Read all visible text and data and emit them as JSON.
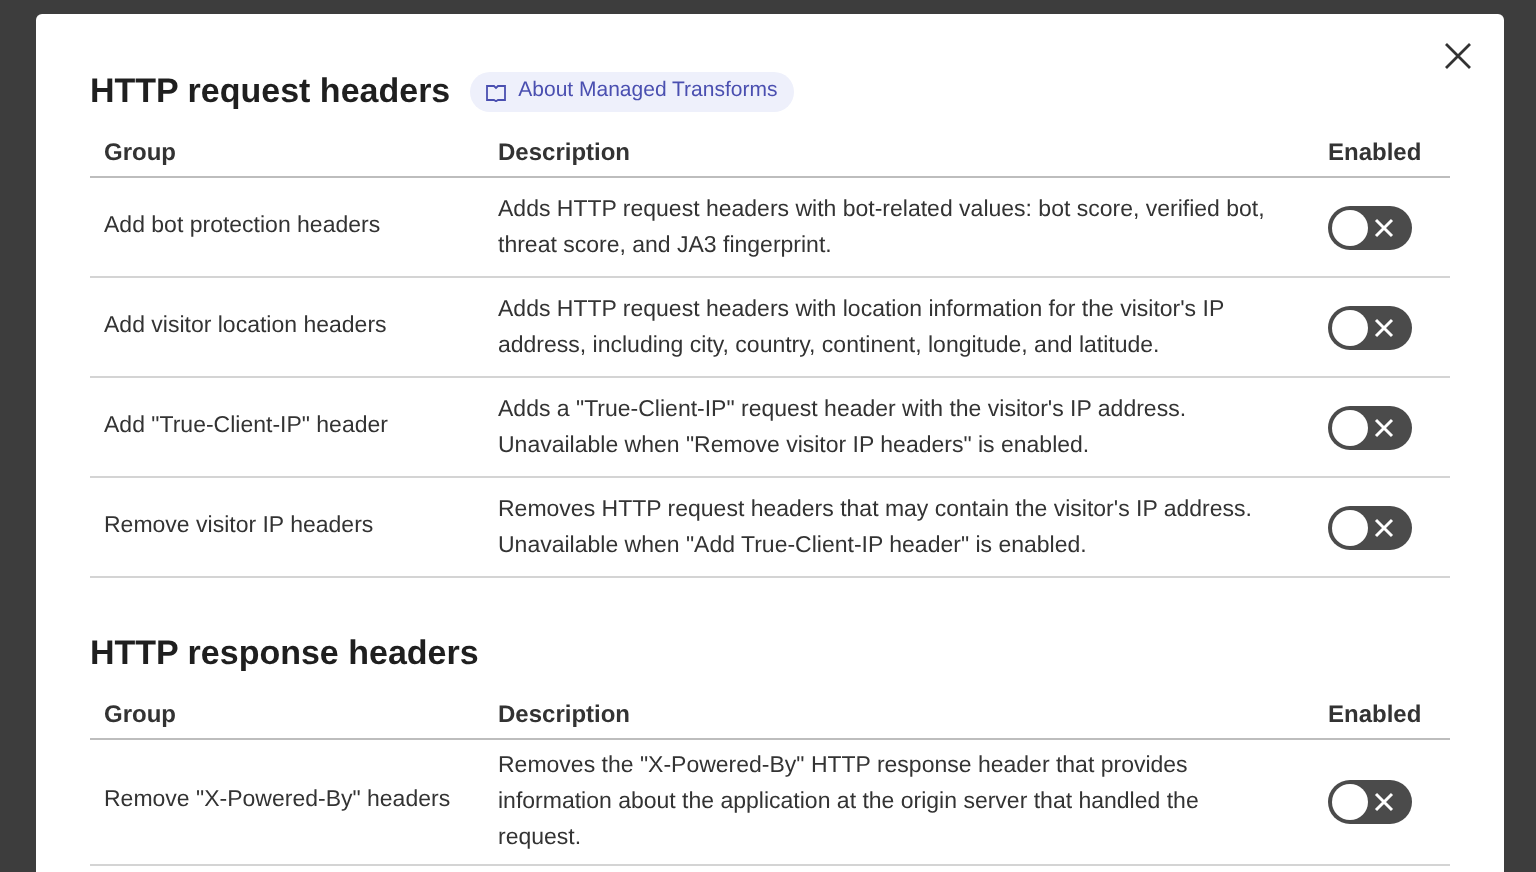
{
  "sections": [
    {
      "title": "HTTP request headers",
      "link": "About Managed Transforms",
      "columns": [
        "Group",
        "Description",
        "Enabled"
      ],
      "rows": [
        {
          "group": "Add bot protection headers",
          "description": "Adds HTTP request headers with bot-related values: bot score, verified bot, threat score, and JA3 fingerprint.",
          "enabled": false
        },
        {
          "group": "Add visitor location headers",
          "description": "Adds HTTP request headers with location information for the visitor's IP address, including city, country, continent, longitude, and latitude.",
          "enabled": false
        },
        {
          "group": "Add \"True-Client-IP\" header",
          "description": "Adds a \"True-Client-IP\" request header with the visitor's IP address. Unavailable when \"Remove visitor IP headers\" is enabled.",
          "enabled": false
        },
        {
          "group": "Remove visitor IP headers",
          "description": "Removes HTTP request headers that may contain the visitor's IP address. Unavailable when \"Add True-Client-IP header\" is enabled.",
          "enabled": false
        }
      ]
    },
    {
      "title": "HTTP response headers",
      "columns": [
        "Group",
        "Description",
        "Enabled"
      ],
      "rows": [
        {
          "group": "Remove \"X-Powered-By\" headers",
          "description": "Removes the \"X-Powered-By\" HTTP response header that provides information about the application at the origin server that handled the request.",
          "enabled": false
        }
      ]
    }
  ]
}
